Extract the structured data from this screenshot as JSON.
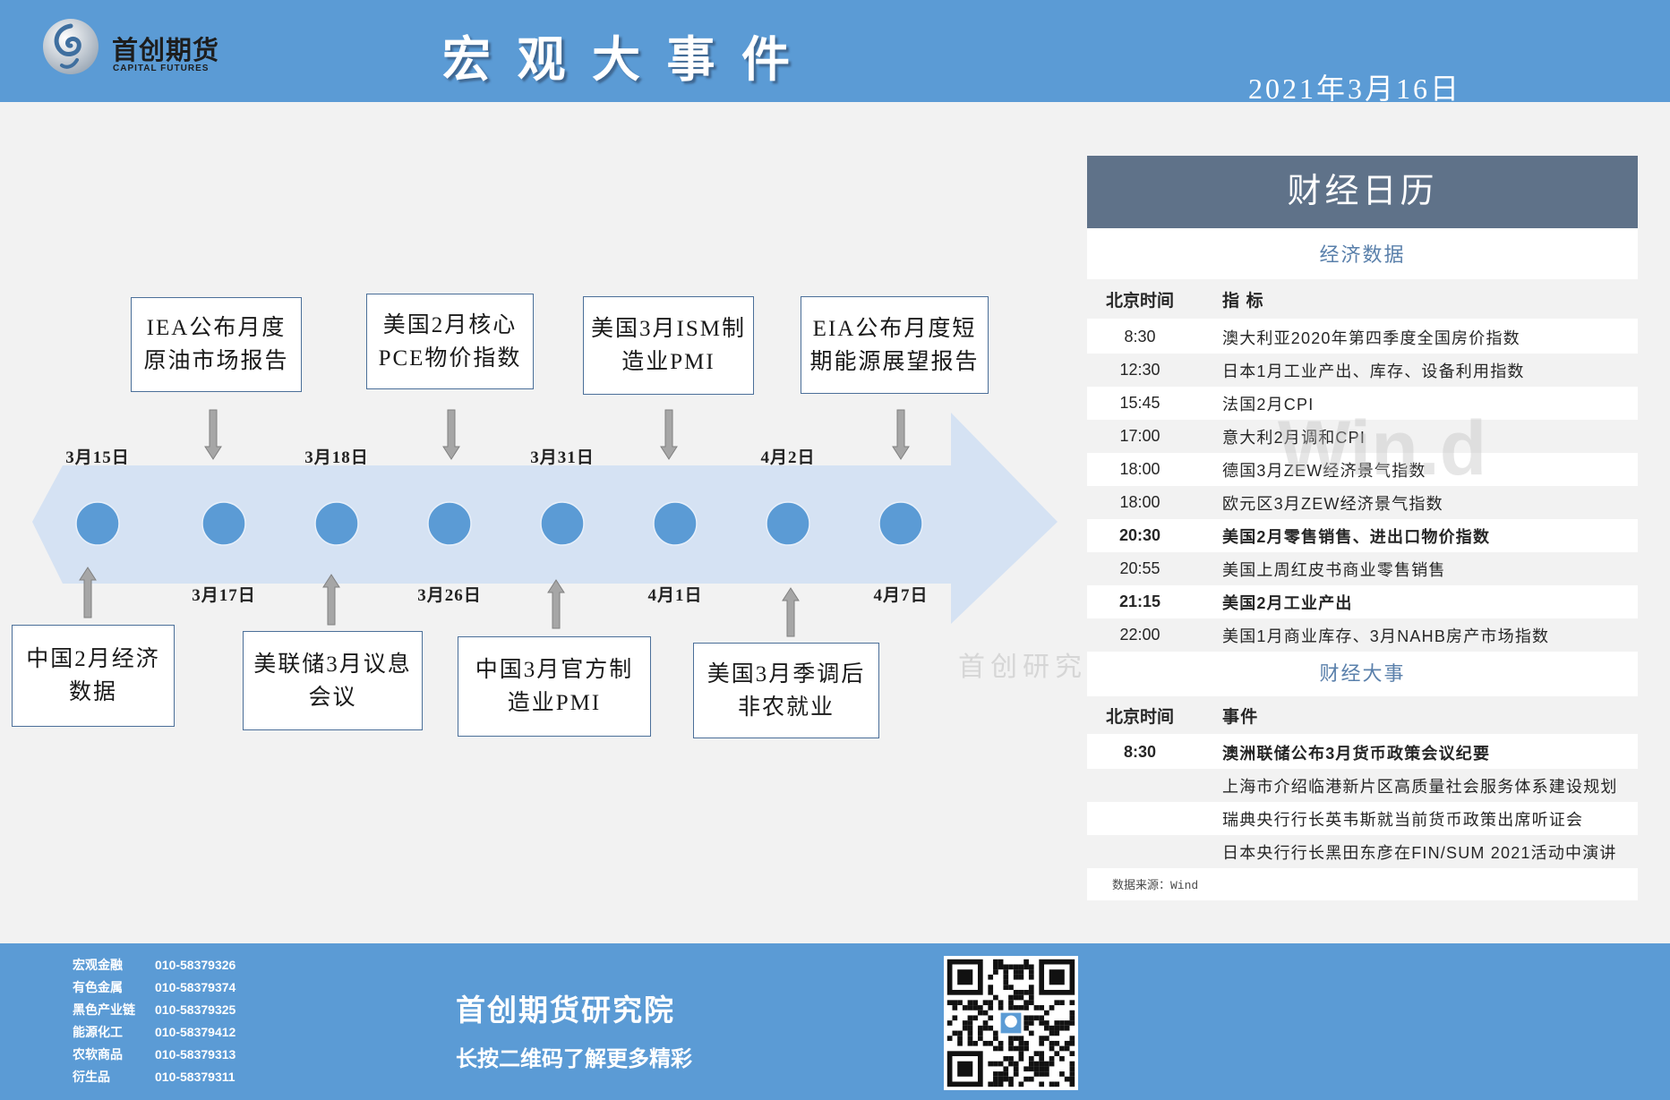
{
  "header": {
    "logo_cn": "首创期货",
    "logo_en": "CAPITAL FUTURES",
    "title": "宏 观 大 事 件",
    "date": "2021年3月16日"
  },
  "timeline": {
    "nodes": [
      {
        "date": "3月15日",
        "event": [
          "中国2月经济",
          "数据"
        ]
      },
      {
        "date": "3月17日",
        "event": [
          "IEA公布月度",
          "原油市场报告"
        ]
      },
      {
        "date": "3月18日",
        "event": [
          "美联储3月议息",
          "会议"
        ]
      },
      {
        "date": "3月26日",
        "event": [
          "美国2月核心",
          "PCE物价指数"
        ]
      },
      {
        "date": "3月31日",
        "event": [
          "中国3月官方制",
          "造业PMI"
        ]
      },
      {
        "date": "4月1日",
        "event": [
          "美国3月ISM制",
          "造业PMI"
        ]
      },
      {
        "date": "4月2日",
        "event": [
          "美国3月季调后",
          "非农就业"
        ]
      },
      {
        "date": "4月7日",
        "event": [
          "EIA公布月度短",
          "期能源展望报告"
        ]
      }
    ]
  },
  "calendar": {
    "title": "财经日历",
    "econ": {
      "heading": "经济数据",
      "col_time": "北京时间",
      "col_item": "指 标",
      "rows": [
        {
          "time": "8:30",
          "item": "澳大利亚2020年第四季度全国房价指数"
        },
        {
          "time": "12:30",
          "item": "日本1月工业产出、库存、设备利用指数"
        },
        {
          "time": "15:45",
          "item": "法国2月CPI"
        },
        {
          "time": "17:00",
          "item": "意大利2月调和CPI"
        },
        {
          "time": "18:00",
          "item": "德国3月ZEW经济景气指数"
        },
        {
          "time": "18:00",
          "item": "欧元区3月ZEW经济景气指数"
        },
        {
          "time": "20:30",
          "item": "美国2月零售销售、进出口物价指数"
        },
        {
          "time": "20:55",
          "item": "美国上周红皮书商业零售销售"
        },
        {
          "time": "21:15",
          "item": "美国2月工业产出"
        },
        {
          "time": "22:00",
          "item": "美国1月商业库存、3月NAHB房产市场指数"
        }
      ]
    },
    "events": {
      "heading": "财经大事",
      "col_time": "北京时间",
      "col_item": "事件",
      "rows": [
        {
          "time": "8:30",
          "item": "澳洲联储公布3月货币政策会议纪要"
        },
        {
          "time": "",
          "item": "上海市介绍临港新片区高质量社会服务体系建设规划"
        },
        {
          "time": "",
          "item": "瑞典央行行长英韦斯就当前货币政策出席听证会"
        },
        {
          "time": "",
          "item": "日本央行行长黑田东彦在FIN/SUM 2021活动中演讲"
        }
      ]
    },
    "source": "数据来源：Wind"
  },
  "watermarks": {
    "wind": "Win.d",
    "brand": "首创研究"
  },
  "footer": {
    "contacts": [
      {
        "dept": "宏观金融",
        "phone": "010-58379326"
      },
      {
        "dept": "有色金属",
        "phone": "010-58379374"
      },
      {
        "dept": "黑色产业链",
        "phone": "010-58379325"
      },
      {
        "dept": "能源化工",
        "phone": "010-58379412"
      },
      {
        "dept": "农软商品",
        "phone": "010-58379313"
      },
      {
        "dept": "衍生品",
        "phone": "010-58379311"
      }
    ],
    "org": "首创期货研究院",
    "slogan": "长按二维码了解更多精彩"
  },
  "icons": {
    "logo": "capital-futures-logo-icon",
    "qr": "qr-code-icon"
  },
  "colors": {
    "brand_blue": "#5b9bd5",
    "calendar_header": "#5f7289",
    "timeline_arrow": "#d5e2f3",
    "node": "#5b9bd5",
    "subheading": "#5a80ab"
  }
}
